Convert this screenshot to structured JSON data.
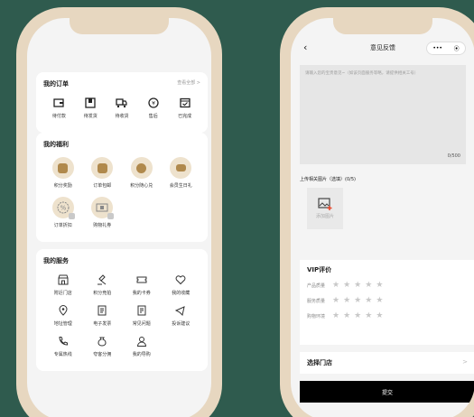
{
  "left": {
    "orders": {
      "title": "我的订单",
      "more": "查看全部 >",
      "items": [
        {
          "label": "待付款",
          "icon": "wallet-icon"
        },
        {
          "label": "待发货",
          "icon": "package-icon"
        },
        {
          "label": "待收货",
          "icon": "truck-icon"
        },
        {
          "label": "售后",
          "icon": "refund-icon"
        },
        {
          "label": "已完成",
          "icon": "done-box-icon"
        }
      ]
    },
    "benefits": {
      "title": "我的福利",
      "items": [
        {
          "label": "积分奖励",
          "icon": "points-reward-icon"
        },
        {
          "label": "订单包邮",
          "icon": "free-shipping-icon"
        },
        {
          "label": "积分随心兑",
          "icon": "points-exchange-icon"
        },
        {
          "label": "会员生日礼",
          "icon": "birthday-cake-icon"
        },
        {
          "label": "订单折扣",
          "icon": "discount-icon"
        },
        {
          "label": "购物礼券",
          "icon": "coupon-icon"
        }
      ]
    },
    "services": {
      "title": "我的服务",
      "items": [
        {
          "label": "附近门店",
          "icon": "store-icon"
        },
        {
          "label": "积分竞拍",
          "icon": "auction-icon"
        },
        {
          "label": "我的卡券",
          "icon": "ticket-icon"
        },
        {
          "label": "我的收藏",
          "icon": "heart-icon"
        },
        {
          "label": "地址管理",
          "icon": "location-icon"
        },
        {
          "label": "电子发票",
          "icon": "invoice-icon"
        },
        {
          "label": "常见问题",
          "icon": "faq-icon"
        },
        {
          "label": "投诉建议",
          "icon": "complaint-icon"
        },
        {
          "label": "专属热线",
          "icon": "phone-icon"
        },
        {
          "label": "夸客分佣",
          "icon": "commission-icon"
        },
        {
          "label": "我的导购",
          "icon": "guide-icon"
        }
      ]
    }
  },
  "right": {
    "nav": {
      "back": "‹",
      "title": "意见反馈",
      "capsule_more": "•••",
      "capsule_close": "⦿"
    },
    "feedback": {
      "placeholder": "请输入您的宝贵意见~（如该页面服务等略，请提供相关工号）",
      "counter": "0/500"
    },
    "upload": {
      "label": "上传相关图片（选填）(0/5)",
      "button": "添加图片"
    },
    "vip": {
      "title": "VIP评价",
      "rows": [
        {
          "label": "产品质量",
          "stars": 5,
          "filled": 0
        },
        {
          "label": "服务质量",
          "stars": 5,
          "filled": 0
        },
        {
          "label": "购物环境",
          "stars": 5,
          "filled": 0
        }
      ]
    },
    "store": {
      "label": "选择门店",
      "chevron": ">"
    },
    "submit": "提交"
  },
  "colors": {
    "background": "#2f5b4e",
    "bezel": "#e7d7c0",
    "gold": "#b0894c",
    "star_empty": "#c8c8c8"
  }
}
